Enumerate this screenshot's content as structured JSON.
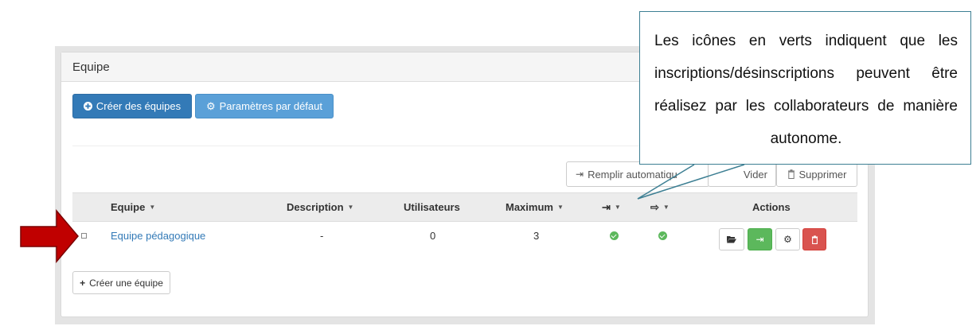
{
  "panel": {
    "title": "Equipe"
  },
  "toolbar": {
    "create_teams_label": "Créer des équipes",
    "defaults_label": "Paramètres par défaut",
    "autofill_label": "Remplir automatiqu",
    "empty_label": "Vider",
    "delete_label": "Supprimer"
  },
  "table": {
    "columns": [
      "Equipe",
      "Description",
      "Utilisateurs",
      "Maximum",
      "",
      "",
      "Actions"
    ],
    "rows": [
      {
        "name": "Equipe pédagogique",
        "description": "-",
        "users": "0",
        "maximum": "3",
        "registration_open": true,
        "unregistration_open": true
      }
    ]
  },
  "footer": {
    "create_team_label": "Créer une équipe"
  },
  "callout": {
    "text": "Les icônes en verts indiquent que les inscriptions/désinscriptions peuvent être réalisez par les collaborateurs de manière autonome."
  },
  "colors": {
    "primary": "#337ab7",
    "success": "#5cb85c",
    "danger": "#d9534f",
    "arrow": "#c00000",
    "callout_border": "#3d7f93"
  }
}
